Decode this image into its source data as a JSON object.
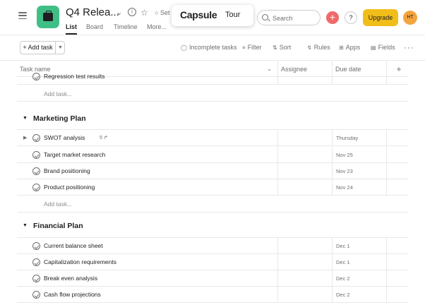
{
  "header": {
    "project_title": "Q4 Relea...",
    "set_status": "Set",
    "tabs": [
      "List",
      "Board",
      "Timeline",
      "More..."
    ],
    "tour": {
      "logo": "Capsule",
      "word": "Tour"
    },
    "search_placeholder": "Search",
    "plus": "+",
    "help": "?",
    "upgrade": "Upgrade",
    "avatar": "HT"
  },
  "toolbar": {
    "add_task": "+ Add task",
    "incomplete": "Incomplete tasks",
    "filter": "Filter",
    "sort": "Sort",
    "rules": "Rules",
    "apps": "Apps",
    "fields": "Fields",
    "more": "···"
  },
  "columns": {
    "name": "Task name",
    "assignee": "Assignee",
    "due": "Due date",
    "add": "+"
  },
  "top_task": {
    "name": "Regression test results"
  },
  "add_task_label": "Add task...",
  "sections": [
    {
      "name": "Marketing Plan",
      "tasks": [
        {
          "name": "SWOT analysis",
          "subtasks": "5",
          "due": "Thursday"
        },
        {
          "name": "Target market research",
          "due": "Nov 25"
        },
        {
          "name": "Brand positioning",
          "due": "Nov 23"
        },
        {
          "name": "Product positioning",
          "due": "Nov 24"
        }
      ]
    },
    {
      "name": "Financial Plan",
      "tasks": [
        {
          "name": "Current balance sheet",
          "due": "Dec 1"
        },
        {
          "name": "Capitalization requirements",
          "due": "Dec 1"
        },
        {
          "name": "Break even analysis",
          "due": "Dec 2"
        },
        {
          "name": "Cash flow projections",
          "due": "Dec 2"
        }
      ]
    }
  ],
  "colors": {
    "accent_green": "#3fbf86",
    "plus_red": "#f06a6a",
    "upgrade_yellow": "#f1bd18",
    "avatar_orange": "#f3a43f"
  }
}
